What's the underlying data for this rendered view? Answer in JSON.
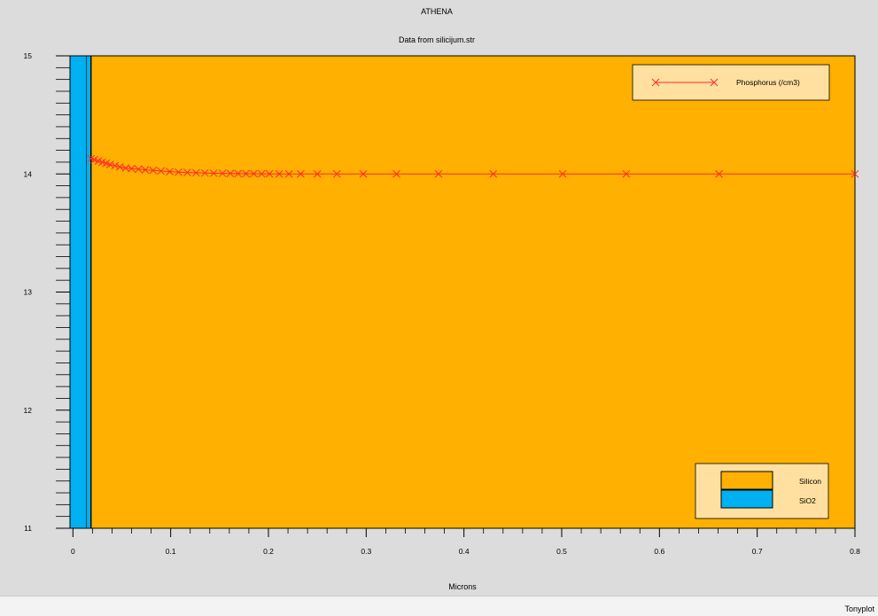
{
  "app": {
    "title": "ATHENA",
    "status_label": "Tonyplot"
  },
  "chart_data": {
    "type": "line",
    "title": "ATHENA",
    "subtitle": "Data from silicijum.str",
    "xlabel": "Microns",
    "ylabel": "",
    "xlim": [
      -0.003,
      0.8
    ],
    "ylim": [
      11,
      15
    ],
    "x_ticks": [
      0,
      0.1,
      0.2,
      0.3,
      0.4,
      0.5,
      0.6,
      0.7,
      0.8
    ],
    "x_tick_labels": [
      "0",
      "0.1",
      "0.2",
      "0.3",
      "0.4",
      "0.5",
      "0.6",
      "0.7",
      "0.8"
    ],
    "y_ticks": [
      11,
      12,
      13,
      14,
      15
    ],
    "y_tick_labels": [
      "11",
      "12",
      "13",
      "14",
      "15"
    ],
    "regions": [
      {
        "name": "SiO2",
        "x_start": -0.003,
        "x_end": 0.0185,
        "color": "#00b0f0"
      },
      {
        "name": "Silicon",
        "x_start": 0.0185,
        "x_end": 0.8,
        "color": "#ffb000"
      }
    ],
    "series": [
      {
        "name": "Phosphorus (/cm3)",
        "color": "#ff2a2a",
        "x": [
          0.0185,
          0.022,
          0.026,
          0.03,
          0.034,
          0.038,
          0.043,
          0.048,
          0.054,
          0.06,
          0.067,
          0.074,
          0.082,
          0.09,
          0.099,
          0.108,
          0.117,
          0.126,
          0.135,
          0.144,
          0.153,
          0.161,
          0.169,
          0.177,
          0.185,
          0.193,
          0.201,
          0.211,
          0.221,
          0.233,
          0.25,
          0.27,
          0.297,
          0.331,
          0.374,
          0.43,
          0.501,
          0.566,
          0.661,
          0.8
        ],
        "y": [
          14.13,
          14.12,
          14.11,
          14.1,
          14.09,
          14.08,
          14.07,
          14.06,
          14.05,
          14.045,
          14.04,
          14.035,
          14.03,
          14.025,
          14.02,
          14.015,
          14.012,
          14.01,
          14.008,
          14.006,
          14.005,
          14.004,
          14.003,
          14.002,
          14.002,
          14.001,
          14.001,
          14.0,
          14.0,
          14.0,
          14.0,
          14.0,
          14.0,
          14.0,
          14.0,
          14.0,
          14.0,
          14.0,
          14.0,
          14.0
        ]
      }
    ],
    "legend": {
      "series_position": "top-right",
      "regions_position": "bottom-right",
      "region_entries": [
        "Silicon",
        "SiO2"
      ]
    },
    "grid": false,
    "colors": {
      "background": "#dcdcdc",
      "axes_frame": "#000000",
      "legend_bg": "#ffe0a0"
    }
  }
}
